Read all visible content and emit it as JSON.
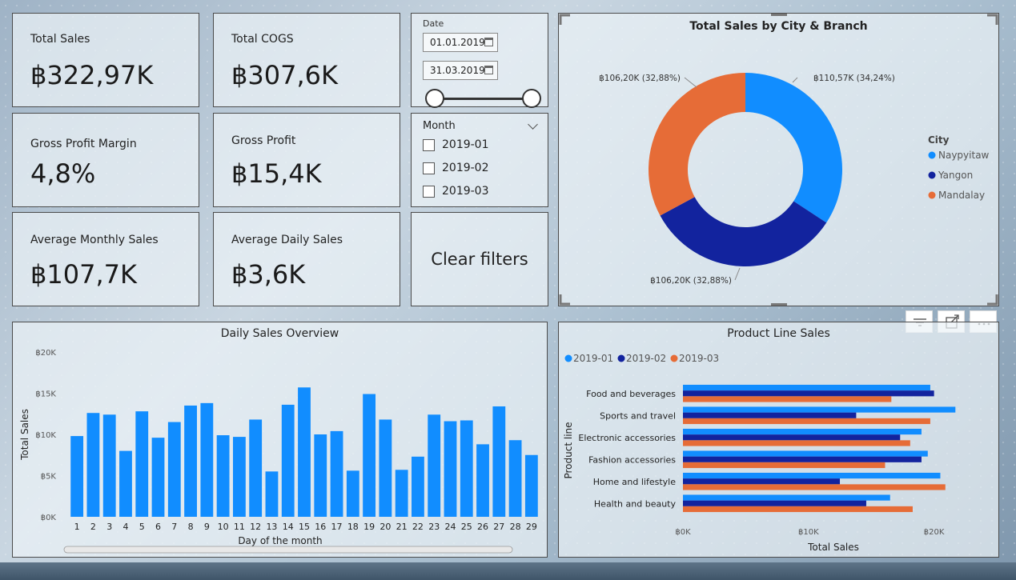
{
  "kpis": {
    "total_sales": {
      "title": "Total Sales",
      "value": "฿322,97K"
    },
    "total_cogs": {
      "title": "Total COGS",
      "value": "฿307,6K"
    },
    "gross_profit_margin": {
      "title": "Gross Profit Margin",
      "value": "4,8%"
    },
    "gross_profit": {
      "title": "Gross Profit",
      "value": "฿15,4K"
    },
    "avg_monthly_sales": {
      "title": "Average Monthly Sales",
      "value": "฿107,7K"
    },
    "avg_daily_sales": {
      "title": "Average Daily Sales",
      "value": "฿3,6K"
    }
  },
  "date_slicer": {
    "label": "Date",
    "start": "01.01.2019",
    "end": "31.03.2019"
  },
  "month_slicer": {
    "title": "Month",
    "items": [
      "2019-01",
      "2019-02",
      "2019-03"
    ]
  },
  "clear_filters_label": "Clear filters",
  "colors": {
    "blue": "#118dff",
    "navy": "#12239e",
    "orange": "#e66c37"
  },
  "chart_data": [
    {
      "type": "pie",
      "variant": "donut",
      "title": "Total Sales by City & Branch",
      "legend_title": "City",
      "legend_position": "right",
      "categories": [
        "Naypyitaw",
        "Yangon",
        "Mandalay"
      ],
      "values": [
        110.57,
        106.2,
        106.2
      ],
      "unit": "฿K",
      "data_labels": [
        "฿110,57K (34,24%)",
        "฿106,20K (32,88%)",
        "฿106,20K (32,88%)"
      ],
      "colors": [
        "#118dff",
        "#12239e",
        "#e66c37"
      ]
    },
    {
      "type": "bar",
      "title": "Daily Sales Overview",
      "xlabel": "Day of the month",
      "ylabel": "Total Sales",
      "ylim": [
        0,
        20000
      ],
      "y_ticks": [
        0,
        5000,
        10000,
        15000,
        20000
      ],
      "y_tick_labels": [
        "฿0K",
        "฿5K",
        "฿10K",
        "฿15K",
        "฿20K"
      ],
      "categories": [
        "1",
        "2",
        "3",
        "4",
        "5",
        "6",
        "7",
        "8",
        "9",
        "10",
        "11",
        "12",
        "13",
        "14",
        "15",
        "16",
        "17",
        "18",
        "19",
        "20",
        "21",
        "22",
        "23",
        "24",
        "25",
        "26",
        "27",
        "28",
        "29"
      ],
      "values": [
        9800,
        12600,
        12400,
        8000,
        12800,
        9600,
        11500,
        13500,
        13800,
        9900,
        9700,
        11800,
        5500,
        13600,
        15700,
        10000,
        10400,
        5600,
        14900,
        11800,
        5700,
        7300,
        12400,
        11600,
        11700,
        8800,
        13400,
        9300,
        7500
      ],
      "color": "#118dff"
    },
    {
      "type": "bar",
      "orientation": "horizontal",
      "title": "Product Line Sales",
      "xlabel": "Total Sales",
      "ylabel": "Product line",
      "xlim": [
        0,
        22000
      ],
      "x_ticks": [
        0,
        10000,
        20000
      ],
      "x_tick_labels": [
        "฿0K",
        "฿10K",
        "฿20K"
      ],
      "legend_position": "top-left",
      "categories": [
        "Food and beverages",
        "Sports and travel",
        "Electronic accessories",
        "Fashion accessories",
        "Home and lifestyle",
        "Health and beauty"
      ],
      "series": [
        {
          "name": "2019-01",
          "color": "#118dff",
          "values": [
            19700,
            21700,
            19000,
            19500,
            20500,
            16500
          ]
        },
        {
          "name": "2019-02",
          "color": "#12239e",
          "values": [
            20000,
            13800,
            17300,
            19000,
            12500,
            14600
          ]
        },
        {
          "name": "2019-03",
          "color": "#e66c37",
          "values": [
            16600,
            19700,
            18100,
            16100,
            20900,
            18300
          ]
        }
      ]
    }
  ]
}
